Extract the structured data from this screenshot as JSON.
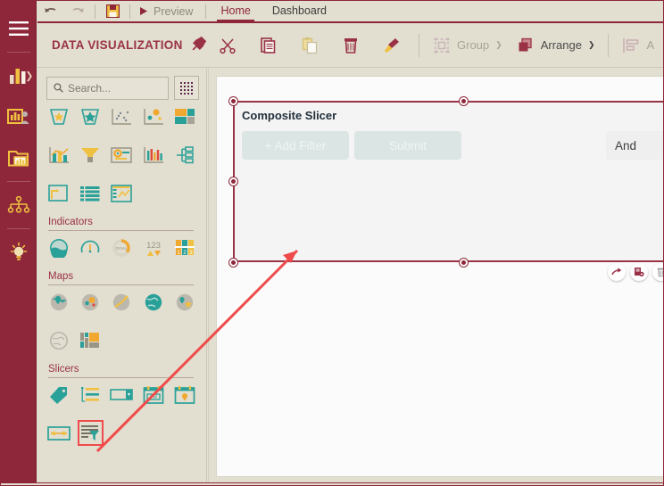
{
  "window": {
    "accent": "#8e2739",
    "panel_bg": "#e2ded0",
    "canvas_bg": "#fbfbfb",
    "highlight": "#ef4b4b"
  },
  "topbar": {
    "undo_label": "Undo",
    "redo_label": "Redo",
    "save_label": "Save",
    "preview_label": "Preview",
    "tabs": [
      {
        "label": "Home",
        "active": true
      },
      {
        "label": "Dashboard",
        "active": false
      }
    ]
  },
  "ribbon": {
    "document_title": "DATA VISUALIZATION",
    "pin_label": "Pin",
    "tools": [
      {
        "name": "cut",
        "label": "Cut"
      },
      {
        "name": "copy",
        "label": "Copy"
      },
      {
        "name": "paste",
        "label": "Paste"
      },
      {
        "name": "delete",
        "label": "Delete"
      },
      {
        "name": "format-painter",
        "label": "Format Painter"
      }
    ],
    "group_label": "Group",
    "arrange_label": "Arrange",
    "align_label": "A"
  },
  "panel": {
    "search": {
      "placeholder": "Search...",
      "value": ""
    },
    "grid_toggle_label": "Toggle view",
    "rows_top": [
      {
        "name": "funnel-pyramid-chart"
      },
      {
        "name": "pyramid-chart"
      },
      {
        "name": "scatter-chart"
      },
      {
        "name": "bubble-chart"
      },
      {
        "name": "treemap-chart"
      },
      {
        "name": "combination-chart"
      },
      {
        "name": "funnel-chart"
      },
      {
        "name": "kpi-card"
      },
      {
        "name": "candlestick-chart"
      },
      {
        "name": "org-chart"
      },
      {
        "name": "area-range-chart"
      },
      {
        "name": "grid-table"
      },
      {
        "name": "pivot-table"
      }
    ],
    "sections": [
      {
        "label": "Indicators",
        "items": [
          {
            "name": "liquid-gauge"
          },
          {
            "name": "circular-gauge"
          },
          {
            "name": "radial-gauge"
          },
          {
            "name": "numeric-indicator"
          },
          {
            "name": "bullet-indicator"
          }
        ]
      },
      {
        "label": "Maps",
        "items": [
          {
            "name": "map-pin"
          },
          {
            "name": "map-bubble"
          },
          {
            "name": "map-flow"
          },
          {
            "name": "map-globe"
          },
          {
            "name": "map-marker-star"
          },
          {
            "name": "map-outline"
          },
          {
            "name": "map-treemap"
          }
        ]
      },
      {
        "label": "Slicers",
        "items": [
          {
            "name": "tag-slicer"
          },
          {
            "name": "list-slicer"
          },
          {
            "name": "dropdown-slicer"
          },
          {
            "name": "date-period-slicer"
          },
          {
            "name": "date-picker-slicer"
          },
          {
            "name": "range-slicer"
          },
          {
            "name": "composite-slicer",
            "highlighted": true
          }
        ]
      }
    ]
  },
  "widget": {
    "title": "Composite Slicer",
    "add_filter_label": "+ Add Filter",
    "submit_label": "Submit",
    "logic_value": "And",
    "actions": [
      {
        "name": "share-action",
        "label": "Share"
      },
      {
        "name": "duplicate-action",
        "label": "Duplicate"
      },
      {
        "name": "delete-action",
        "label": "Delete"
      }
    ]
  },
  "rail": {
    "items": [
      {
        "name": "menu",
        "label": "Menu"
      },
      {
        "name": "dashboards",
        "label": "Dashboards"
      },
      {
        "name": "shared-dashboards",
        "label": "Shared"
      },
      {
        "name": "folders",
        "label": "Folders"
      },
      {
        "name": "data-sources",
        "label": "Data Sources"
      },
      {
        "name": "insights",
        "label": "Insights"
      }
    ]
  }
}
